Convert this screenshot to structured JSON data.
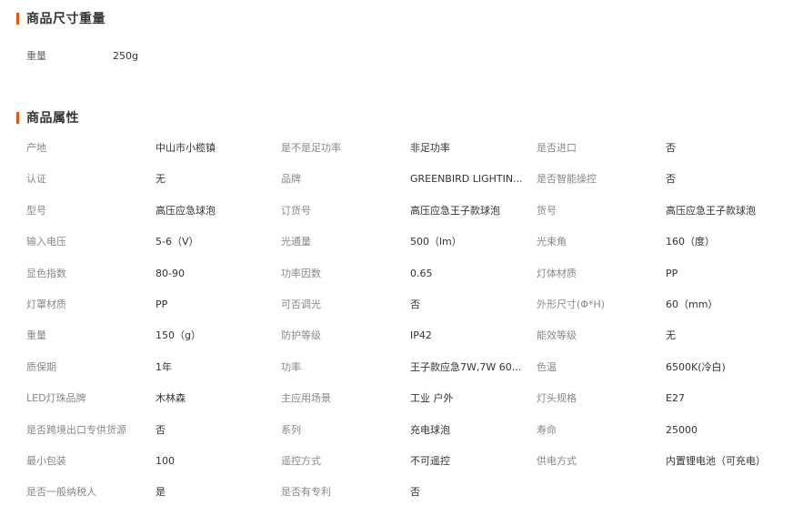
{
  "section_size": {
    "title": "商品尺寸重量"
  },
  "weight": {
    "label": "重量",
    "value": "250g"
  },
  "section_attrs": {
    "title": "商品属性"
  },
  "rows": [
    [
      [
        "产地",
        "中山市小榄镇"
      ],
      [
        "是不是足功率",
        "非足功率"
      ],
      [
        "是否进口",
        "否"
      ]
    ],
    [
      [
        "认证",
        "无"
      ],
      [
        "品牌",
        "GREENBIRD LIGHTIN..."
      ],
      [
        "是否智能操控",
        "否"
      ]
    ],
    [
      [
        "型号",
        "高压应急球泡"
      ],
      [
        "订货号",
        "高压应急王子款球泡"
      ],
      [
        "货号",
        "高压应急王子款球泡"
      ]
    ],
    [
      [
        "输入电压",
        "5-6（V）"
      ],
      [
        "光通量",
        "500（lm）"
      ],
      [
        "光束角",
        "160（度）"
      ]
    ],
    [
      [
        "显色指数",
        "80-90"
      ],
      [
        "功率因数",
        "0.65"
      ],
      [
        "灯体材质",
        "PP"
      ]
    ],
    [
      [
        "灯罩材质",
        "PP"
      ],
      [
        "可否调光",
        "否"
      ],
      [
        "外形尺寸(Φ*H)",
        "60（mm）"
      ]
    ],
    [
      [
        "重量",
        "150（g）"
      ],
      [
        "防护等级",
        "IP42"
      ],
      [
        "能效等级",
        "无"
      ]
    ],
    [
      [
        "质保期",
        "1年"
      ],
      [
        "功率",
        "王子款应急7W,7W 60..."
      ],
      [
        "色温",
        "6500K(冷白)"
      ]
    ],
    [
      [
        "LED灯珠品牌",
        "木林森"
      ],
      [
        "主应用场景",
        "工业 户外"
      ],
      [
        "灯头规格",
        "E27"
      ]
    ],
    [
      [
        "是否跨境出口专供货源",
        "否"
      ],
      [
        "系列",
        "充电球泡"
      ],
      [
        "寿命",
        "25000"
      ]
    ],
    [
      [
        "最小包装",
        "100"
      ],
      [
        "遥控方式",
        "不可遥控"
      ],
      [
        "供电方式",
        "内置锂电池（可充电）"
      ]
    ],
    [
      [
        "是否一般纳税人",
        "是"
      ],
      [
        "是否有专利",
        "否"
      ]
    ]
  ]
}
